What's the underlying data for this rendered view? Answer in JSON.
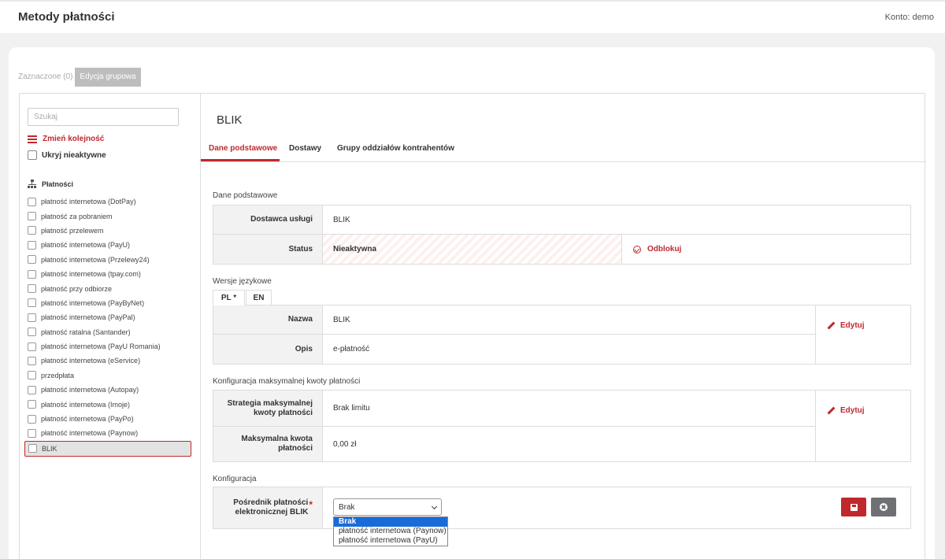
{
  "header": {
    "title": "Metody płatności",
    "account": "Konto: demo"
  },
  "toolbar": {
    "selected": "Zaznaczone (0)",
    "group_edit": "Edycja grupowa"
  },
  "sidebar": {
    "search_placeholder": "Szukaj",
    "reorder": "Zmień kolejność",
    "hide_inactive": "Ukryj nieaktywne",
    "tree_title": "Płatności",
    "items": [
      "płatność internetowa (DotPay)",
      "płatność za pobraniem",
      "płatność przelewem",
      "płatność internetowa (PayU)",
      "płatność internetowa (Przelewy24)",
      "płatność internetowa (tpay.com)",
      "płatność przy odbiorze",
      "płatność internetowa (PayByNet)",
      "płatność internetowa (PayPal)",
      "płatność ratalna (Santander)",
      "płatność internetowa (PayU Romania)",
      "płatność internetowa (eService)",
      "przedpłata",
      "płatność internetowa (Autopay)",
      "płatność internetowa (Imoje)",
      "płatność internetowa (PayPo)",
      "płatność internetowa (Paynow)",
      "BLIK"
    ]
  },
  "main": {
    "title": "BLIK",
    "tabs": [
      "Dane podstawowe",
      "Dostawy",
      "Grupy oddziałów kontrahentów"
    ],
    "basic": {
      "section": "Dane podstawowe",
      "provider_label": "Dostawca usługi",
      "provider_value": "BLIK",
      "status_label": "Status",
      "status_value": "Nieaktywna",
      "unlock": "Odblokuj"
    },
    "lang": {
      "section": "Wersje językowe",
      "tab_pl": "PL *",
      "tab_en": "EN",
      "name_label": "Nazwa",
      "name_value": "BLIK",
      "desc_label": "Opis",
      "desc_value": "e-płatność",
      "edit": "Edytuj"
    },
    "maxamount": {
      "section": "Konfiguracja maksymalnej kwoty płatności",
      "strategy_label": "Strategia maksymalnej kwoty płatności",
      "strategy_value": "Brak limitu",
      "max_label": "Maksymalna kwota płatności",
      "max_value": "0,00 zł",
      "edit": "Edytuj"
    },
    "config": {
      "section": "Konfiguracja",
      "broker_label": "Pośrednik płatności elektronicznej BLIK",
      "required_mark": "*",
      "select_value": "Brak",
      "options": [
        "Brak",
        "płatność internetowa (Paynow)",
        "płatność internetowa (PayU)"
      ]
    }
  }
}
